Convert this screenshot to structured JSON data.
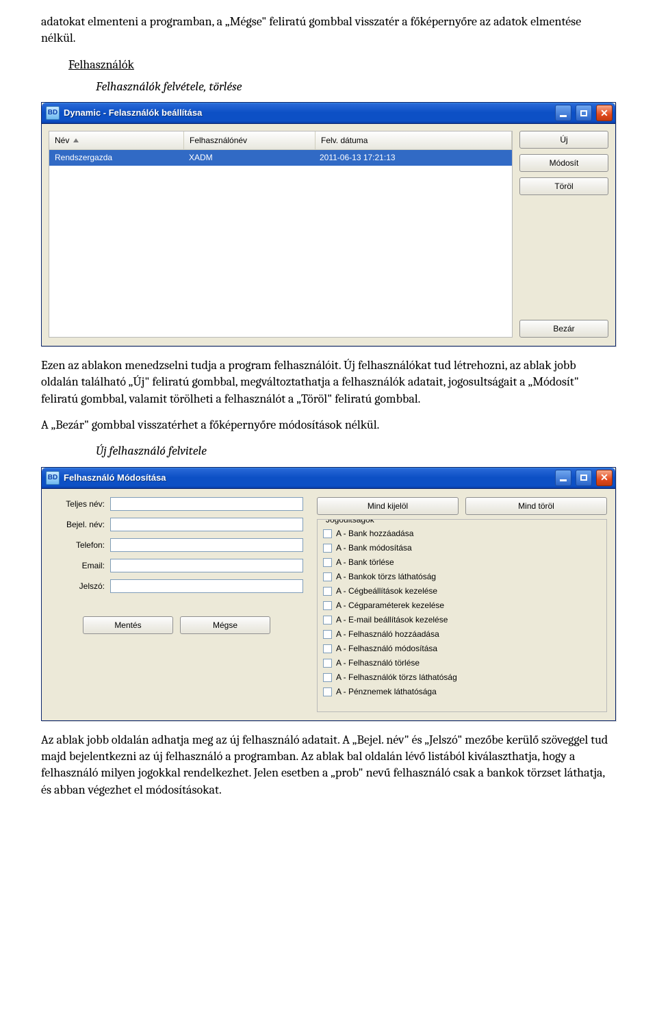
{
  "doc": {
    "intro": "adatokat elmenteni a programban, a „Mégse\" feliratú gombbal visszatér a főképernyőre az adatok elmentése nélkül.",
    "section_users": "Felhasználók",
    "sub_add_remove": "Felhasználók felvétele, törlése",
    "para2": "Ezen az ablakon menedzselni tudja a program felhasználóit. Új felhasználókat tud létrehozni, az ablak jobb oldalán található „Új\" feliratú gombbal, megváltoztathatja a felhasználók adatait, jogosultságait a „Módosít\" feliratú gombbal, valamit törölheti a felhasználót a „Töröl\" feliratú gombbal.",
    "para3": "A „Bezár\" gombbal visszatérhet a főképernyőre módosítások nélkül.",
    "sub_new_user": "Új felhasználó felvitele",
    "para4": "Az ablak jobb oldalán adhatja meg az új felhasználó adatait. A „Bejel. név\" és „Jelszó\" mezőbe kerülő szöveggel tud majd bejelentkezni az új felhasználó a programban. Az ablak bal oldalán lévő listából kiválaszthatja, hogy a felhasználó milyen jogokkal rendelkezhet. Jelen esetben a „prob\" nevű felhasználó csak a bankok törzset láthatja, és abban végezhet el módosításokat."
  },
  "window1": {
    "app_logo_text": "BD",
    "title": "Dynamic - Felasználók beállítása",
    "columns": {
      "name": "Név",
      "username": "Felhasználónév",
      "date": "Felv. dátuma"
    },
    "rows": [
      {
        "name": "Rendszergazda",
        "username": "XADM",
        "date": "2011-06-13 17:21:13"
      }
    ],
    "buttons": {
      "new": "Új",
      "modify": "Módosít",
      "delete": "Töröl",
      "close": "Bezár"
    }
  },
  "window2": {
    "app_logo_text": "BD",
    "title": "Felhasználó Módosítása",
    "labels": {
      "fullname": "Teljes név:",
      "loginname": "Bejel. név:",
      "phone": "Telefon:",
      "email": "Email:",
      "password": "Jelszó:"
    },
    "values": {
      "fullname": "",
      "loginname": "",
      "phone": "",
      "email": "",
      "password": ""
    },
    "top_buttons": {
      "select_all": "Mind kijelöl",
      "clear_all": "Mind töröl"
    },
    "group_label": "Jogoultságok",
    "permissions": [
      "A - Bank hozzáadása",
      "A - Bank módosítása",
      "A - Bank törlése",
      "A - Bankok törzs láthatóság",
      "A - Cégbeállítások kezelése",
      "A - Cégparaméterek kezelése",
      "A - E-mail beállítások kezelése",
      "A - Felhasználó hozzáadása",
      "A - Felhasználó módosítása",
      "A - Felhasználó törlése",
      "A - Felhasználók törzs láthatóság",
      "A - Pénznemek láthatósága"
    ],
    "form_buttons": {
      "save": "Mentés",
      "cancel": "Mégse"
    }
  }
}
